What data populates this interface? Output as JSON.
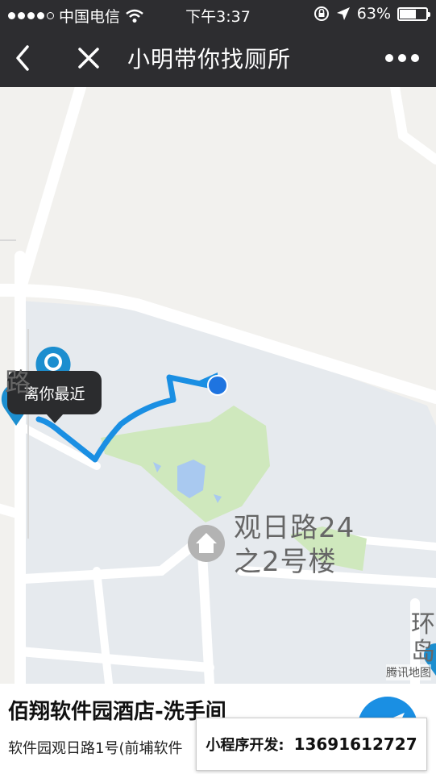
{
  "status_bar": {
    "carrier": "中国电信",
    "time": "下午3:37",
    "battery_percent": "63%",
    "battery_level": 0.63
  },
  "nav": {
    "back_icon": "chevron-left-icon",
    "close_icon": "close-icon",
    "title": "小明带你找厕所",
    "more_icon": "more-dots-icon"
  },
  "map": {
    "tooltip": "离你最近",
    "side_label": "路",
    "poi_label_line1": "观日路24",
    "poi_label_line2": "之2号楼",
    "corner_label_line1": "环",
    "corner_label_line2": "岛",
    "watermark": "腾讯地图",
    "route_color": "#1a8fe3",
    "marker_color": "#1c8ecf"
  },
  "place": {
    "name": "佰翔软件园酒店-洗手间",
    "address": "软件园观日路1号(前埔软件"
  },
  "promo": {
    "label": "小程序开发:",
    "phone": "13691612727"
  }
}
